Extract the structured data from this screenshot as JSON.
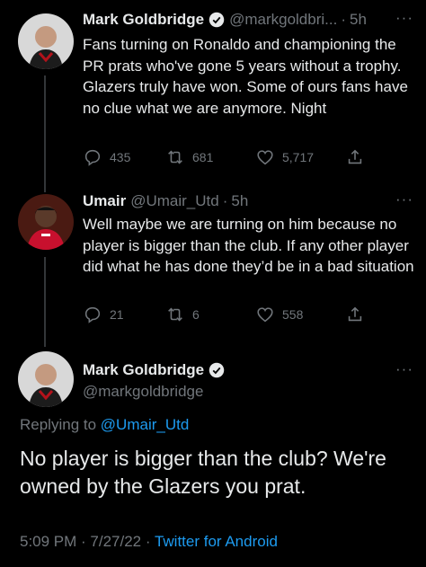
{
  "tweets": [
    {
      "name": "Mark Goldbridge",
      "handle": "@markgoldbri...",
      "time": "5h",
      "text": "Fans turning on Ronaldo and championing the PR prats who've gone 5 years without a trophy. Glazers truly have won. Some of ours fans have no clue what we are anymore. Night",
      "replies": "435",
      "retweets": "681",
      "likes": "5,717",
      "verified": true
    },
    {
      "name": "Umair",
      "handle": "@Umair_Utd",
      "time": "5h",
      "text": "Well maybe we are turning on him because no player is bigger than the club. If any other player did what he has done they’d be in a bad situation",
      "replies": "21",
      "retweets": "6",
      "likes": "558",
      "verified": false
    }
  ],
  "main_tweet": {
    "name": "Mark Goldbridge",
    "handle": "@markgoldbridge",
    "replying_prefix": "Replying to",
    "replying_to": "@Umair_Utd",
    "text": "No player is bigger than the club? We're owned by the Glazers you prat.",
    "datetime": "5:09 PM · 7/27/22 · ",
    "source": "Twitter for Android"
  },
  "colors": {
    "background": "#000000",
    "text": "#e7e9ea",
    "muted": "#71767b",
    "accent": "#1d9bf0",
    "thread_line": "#333639"
  },
  "icons": [
    "verified-badge-icon",
    "more-icon",
    "reply-icon",
    "retweet-icon",
    "like-icon",
    "share-icon"
  ]
}
